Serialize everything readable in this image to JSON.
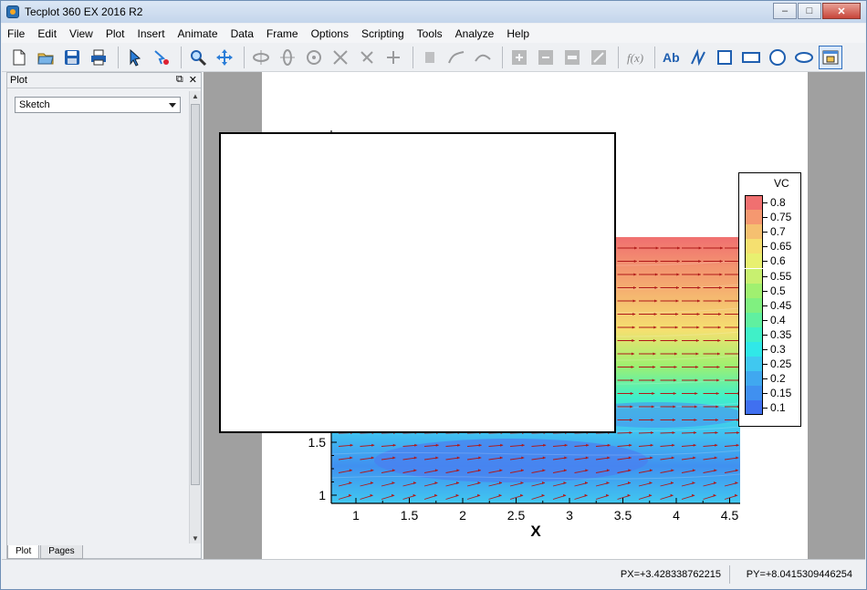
{
  "window": {
    "title": "Tecplot 360 EX 2016 R2"
  },
  "menu": [
    "File",
    "Edit",
    "View",
    "Plot",
    "Insert",
    "Animate",
    "Data",
    "Frame",
    "Options",
    "Scripting",
    "Tools",
    "Analyze",
    "Help"
  ],
  "toolbar_icons": [
    "new-file-icon",
    "open-file-icon",
    "save-icon",
    "print-icon",
    "select-arrow-icon",
    "adjustor-icon",
    "zoom-icon",
    "translate-icon",
    "rotate-x-icon",
    "rotate-y-icon",
    "rotate-z-icon",
    "rotate-xy-icon",
    "rotate-yz-icon",
    "rotate-zx-icon",
    "probe-icon",
    "streamtrace-icon",
    "slice-icon",
    "contour-add-icon",
    "contour-remove-icon",
    "contour-level-icon",
    "zone-edit-icon",
    "fx-equation-icon",
    "text-tool-icon",
    "polyline-tool-icon",
    "square-tool-icon",
    "rectangle-tool-icon",
    "circle-tool-icon",
    "ellipse-tool-icon",
    "frame-tool-icon"
  ],
  "side_panel": {
    "title": "Plot",
    "mode_dropdown": "Sketch",
    "tabs": [
      "Plot",
      "Pages"
    ]
  },
  "status": {
    "px": "PX=+3.428338762215",
    "py": "PY=+8.0415309446254"
  },
  "colors": {
    "frame_bg": "#ffffff",
    "workspace_bg": "#a0a0a0",
    "vector": "#b01818"
  },
  "chart_data": {
    "type": "contour",
    "xlabel": "X",
    "x_ticks": [
      "1",
      "1.5",
      "2",
      "2.5",
      "3",
      "3.5",
      "4",
      "4.5"
    ],
    "y_ticks": [
      "1",
      "1.5"
    ],
    "legend": {
      "title": "VC",
      "levels": [
        "0.8",
        "0.75",
        "0.7",
        "0.65",
        "0.6",
        "0.55",
        "0.5",
        "0.45",
        "0.4",
        "0.35",
        "0.3",
        "0.25",
        "0.2",
        "0.15",
        "0.1"
      ],
      "colors": [
        "#f07070",
        "#f59870",
        "#f5c070",
        "#f5e070",
        "#e8f070",
        "#c8f070",
        "#a0f070",
        "#80f080",
        "#60f0a0",
        "#40f0c8",
        "#30e8e8",
        "#40c8f0",
        "#40a8f0",
        "#4090f0",
        "#4070f0"
      ]
    }
  }
}
